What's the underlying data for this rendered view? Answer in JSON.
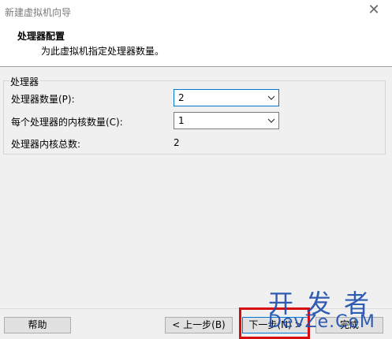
{
  "window": {
    "title": "新建虚拟机向导"
  },
  "header": {
    "title": "处理器配置",
    "subtitle": "为此虚拟机指定处理器数量。"
  },
  "processors": {
    "group_label": "处理器",
    "count_label": "处理器数量(P):",
    "count_value": "2",
    "cores_label": "每个处理器的内核数量(C):",
    "cores_value": "1",
    "total_label": "处理器内核总数:",
    "total_value": "2"
  },
  "buttons": {
    "help": "帮助",
    "back": "< 上一步(B)",
    "next": "下一步(N) >",
    "finish": "完成"
  },
  "watermark": {
    "line1": "开发者",
    "line2": "DevZe.CoM"
  },
  "colors": {
    "highlight": "#d80c0c",
    "focus": "#0078d7",
    "watermark": "#1f4fae"
  }
}
